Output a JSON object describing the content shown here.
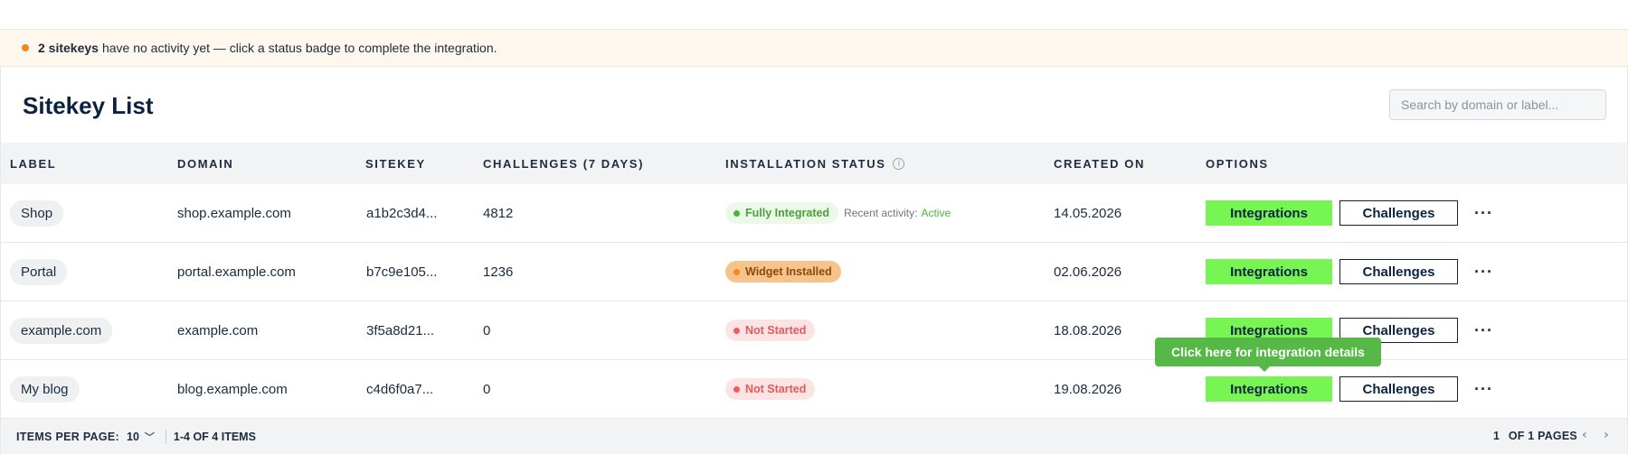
{
  "notice": {
    "count_text": "2 sitekeys",
    "message": "have no activity yet — click a status badge to complete the integration."
  },
  "page": {
    "title": "Sitekey List",
    "search_placeholder": "Search by domain or label..."
  },
  "table": {
    "columns": [
      "LABEL",
      "DOMAIN",
      "SITEKEY",
      "CHALLENGES (7 DAYS)",
      "INSTALLATION STATUS",
      "CREATED ON",
      "OPTIONS"
    ],
    "rows": [
      {
        "label": "Shop",
        "domain": "shop.example.com",
        "sitekey": "a1b2c3d4...",
        "challenges": "4812",
        "status": "Fully Integrated",
        "activity_label": "Recent activity:",
        "activity_value": "Active",
        "created": "14.05.2026"
      },
      {
        "label": "Portal",
        "domain": "portal.example.com",
        "sitekey": "b7c9e105...",
        "challenges": "1236",
        "status": "Widget Installed",
        "created": "02.06.2026"
      },
      {
        "label": "example.com",
        "domain": "example.com",
        "sitekey": "3f5a8d21...",
        "challenges": "0",
        "status": "Not Started",
        "created": "18.08.2026"
      },
      {
        "label": "My blog",
        "domain": "blog.example.com",
        "sitekey": "c4d6f0a7...",
        "challenges": "0",
        "status": "Not Started",
        "created": "19.08.2026"
      }
    ],
    "integrations_label": "Integrations",
    "challenges_label": "Challenges",
    "more_label": "···",
    "info_icon": "i"
  },
  "tooltip": {
    "text": "Click here for integration details"
  },
  "footer": {
    "items_per_page_label": "ITEMS PER PAGE:",
    "items_per_page_value": "10",
    "range_text": "1-4 OF 4 ITEMS",
    "page_current": "1",
    "page_of_text": "OF 1 PAGES",
    "prev_glyph": "‹",
    "next_glyph": "›",
    "chevron_glyph": "﹀"
  },
  "colors": {
    "accent_green": "#76f553",
    "navy": "#0b2340",
    "tooltip_green": "#56b947",
    "warning_dot": "#f0861d"
  }
}
